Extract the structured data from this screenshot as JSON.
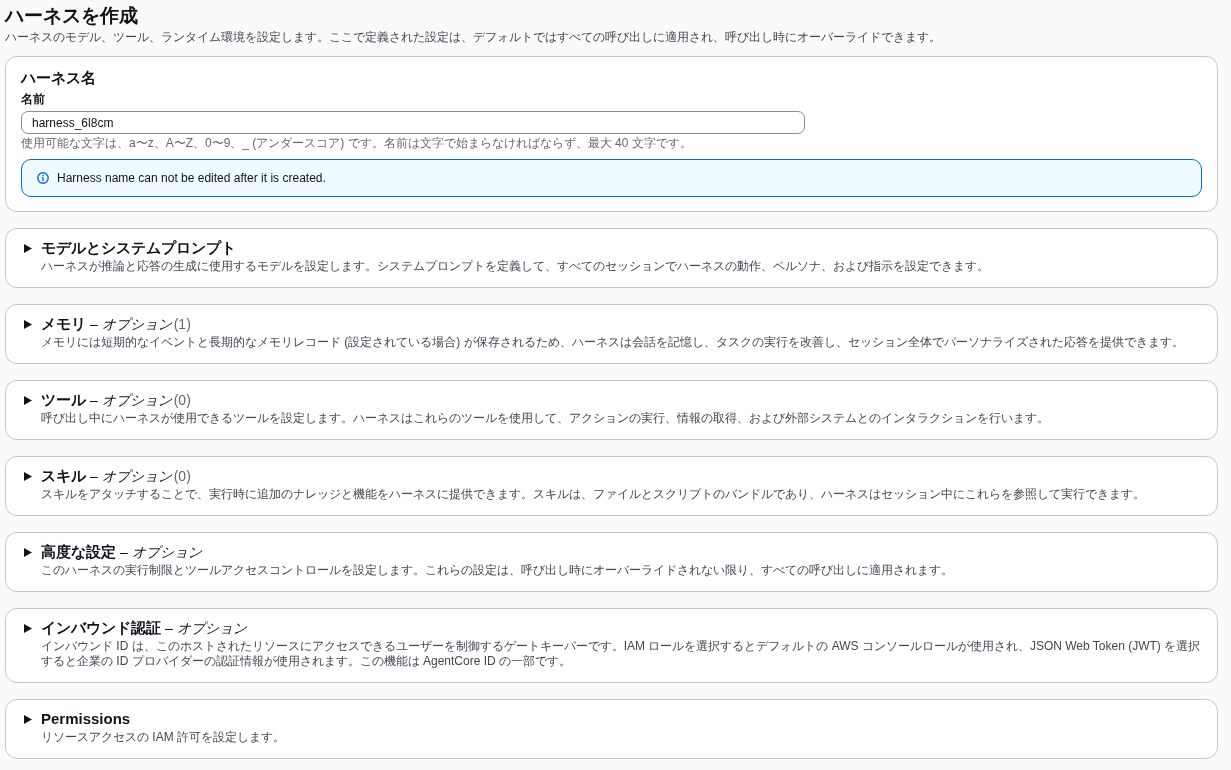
{
  "page": {
    "title": "ハーネスを作成",
    "description": "ハーネスのモデル、ツール、ランタイム環境を設定します。ここで定義された設定は、デフォルトではすべての呼び出しに適用され、呼び出し時にオーバーライドできます。"
  },
  "name_section": {
    "title": "ハーネス名",
    "field_label": "名前",
    "value": "harness_6l8cm",
    "hint": "使用可能な文字は、a〜z、A〜Z、0〜9、_ (アンダースコア) です。名前は文字で始まらなければならず、最大 40 文字です。",
    "alert": {
      "kind": "info",
      "text": "Harness name can not be edited after it is created."
    }
  },
  "sections": [
    {
      "title": "モデルとシステムプロンプト",
      "expanded": false,
      "description": "ハーネスが推論と応答の生成に使用するモデルを設定します。システムプロンプトを定義して、すべてのセッションでハーネスの動作、ペルソナ、および指示を設定できます。"
    },
    {
      "title": "メモリ",
      "optional_label": "– *オプション*",
      "count": "(1)",
      "expanded": false,
      "description": "メモリには短期的なイベントと長期的なメモリレコード (設定されている場合) が保存されるため、ハーネスは会話を記憶し、タスクの実行を改善し、セッション全体でパーソナライズされた応答を提供できます。"
    },
    {
      "title": "ツール",
      "optional_label": "– *オプション*",
      "count": "(0)",
      "expanded": false,
      "description": "呼び出し中にハーネスが使用できるツールを設定します。ハーネスはこれらのツールを使用して、アクションの実行、情報の取得、および外部システムとのインタラクションを行います。"
    },
    {
      "title": "スキル",
      "optional_label": "– *オプション*",
      "count": "(0)",
      "expanded": false,
      "description": "スキルをアタッチすることで、実行時に追加のナレッジと機能をハーネスに提供できます。スキルは、ファイルとスクリプトのバンドルであり、ハーネスはセッション中にこれらを参照して実行できます。"
    },
    {
      "title": "高度な設定",
      "optional_label": "– *オプション*",
      "expanded": false,
      "description": "このハーネスの実行制限とツールアクセスコントロールを設定します。これらの設定は、呼び出し時にオーバーライドされない限り、すべての呼び出しに適用されます。"
    },
    {
      "title": "インバウンド認証",
      "optional_label": "– *オプション*",
      "expanded": false,
      "description": "インバウンド ID は、このホストされたリソースにアクセスできるユーザーを制御するゲートキーパーです。IAM ロールを選択するとデフォルトの AWS コンソールロールが使用され、JSON Web Token (JWT) を選択すると企業の ID プロバイダーの認証情報が使用されます。この機能は AgentCore ID の一部です。"
    },
    {
      "title": "Permissions",
      "expanded": false,
      "description": "リソースアクセスの IAM 許可を設定します。"
    }
  ]
}
